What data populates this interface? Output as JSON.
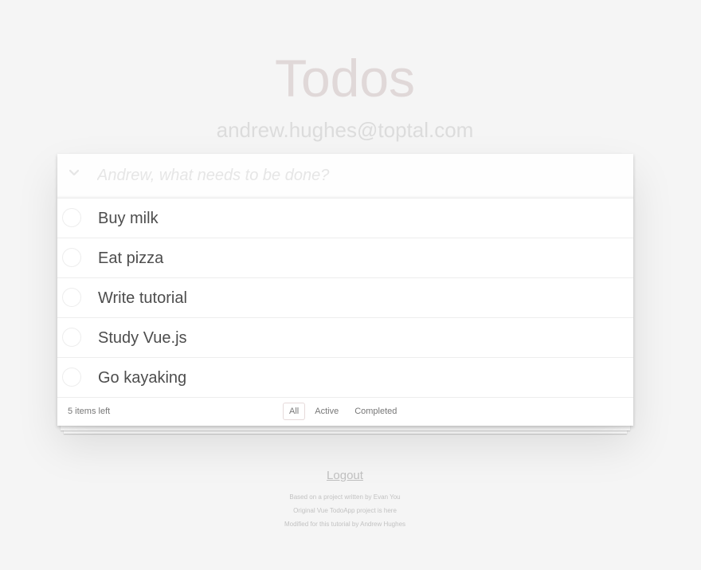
{
  "app": {
    "title": "Todos",
    "user_email": "andrew.hughes@toptal.com"
  },
  "new_todo": {
    "placeholder": "Andrew, what needs to be done?",
    "value": ""
  },
  "todos": [
    {
      "label": "Buy milk",
      "completed": false
    },
    {
      "label": "Eat pizza",
      "completed": false
    },
    {
      "label": "Write tutorial",
      "completed": false
    },
    {
      "label": "Study Vue.js",
      "completed": false
    },
    {
      "label": "Go kayaking",
      "completed": false
    }
  ],
  "footer": {
    "items_left": "5 items left",
    "filters": [
      {
        "label": "All",
        "selected": true
      },
      {
        "label": "Active",
        "selected": false
      },
      {
        "label": "Completed",
        "selected": false
      }
    ]
  },
  "logout_label": "Logout",
  "info": [
    "Based on a project written by Evan You",
    "Original Vue TodoApp project is here",
    "Modified for this tutorial by Andrew Hughes"
  ],
  "icons": {
    "toggle_all": "chevron-down-icon"
  },
  "colors": {
    "background": "#f5f5f5",
    "title": "#e0d8d8",
    "text": "#4d4d4d",
    "selected_filter_border": "#e6dada"
  }
}
